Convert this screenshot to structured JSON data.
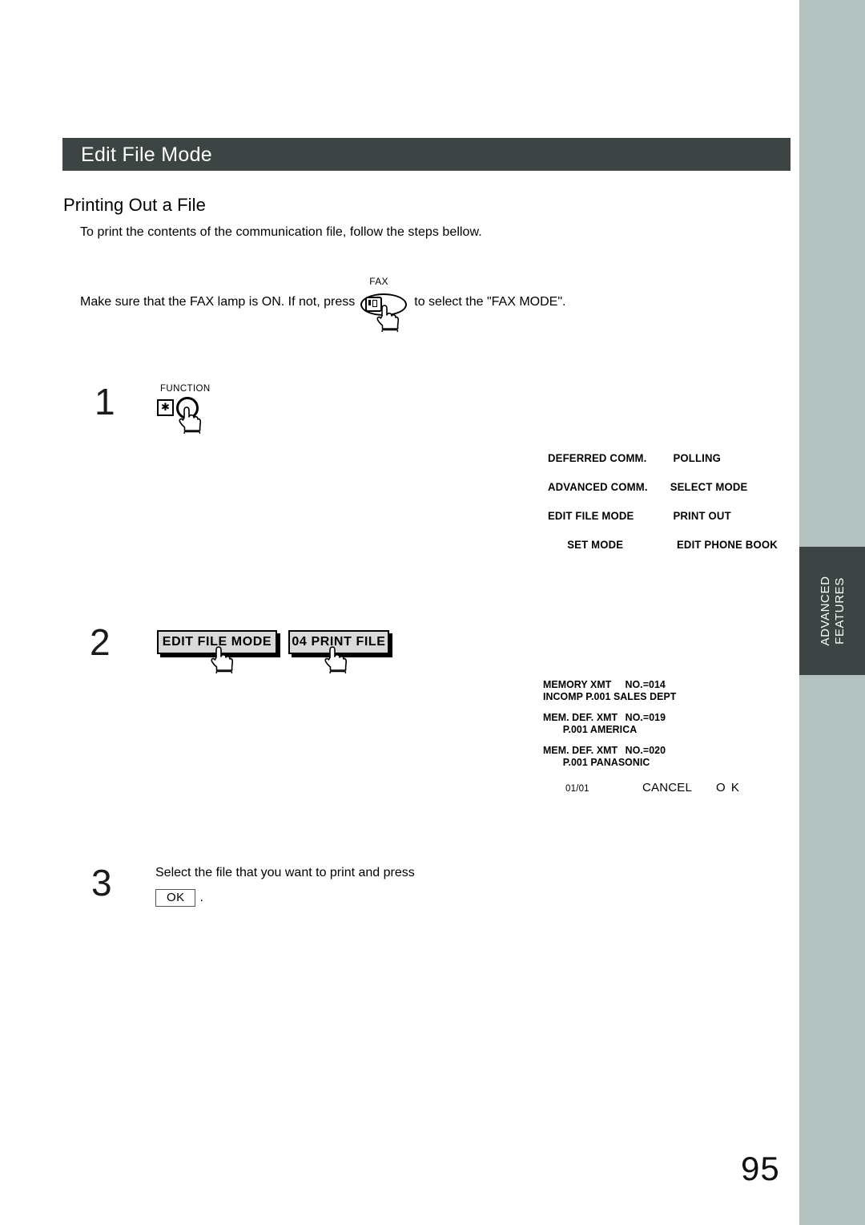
{
  "header": {
    "title": "Edit File Mode"
  },
  "section": {
    "heading": "Printing Out a File",
    "intro": "To print the contents of the communication file, follow the steps bellow."
  },
  "fax_instruction": {
    "before": "Make sure that the FAX lamp is ON.  If not, press",
    "key_label": "FAX",
    "key_icon": "fax-machine-icon",
    "after": "to select the \"FAX MODE\"."
  },
  "steps": [
    {
      "number": "1",
      "function_key_label": "FUNCTION",
      "star_key_label": "✱"
    },
    {
      "number": "2",
      "buttons": [
        {
          "label": "EDIT FILE MODE"
        },
        {
          "label": "04 PRINT FILE"
        }
      ]
    },
    {
      "number": "3",
      "text": "Select the file that you want to print and press",
      "ok_label": "OK",
      "period": "."
    }
  ],
  "menu_display": {
    "rows": [
      {
        "left": "DEFERRED COMM.",
        "right": "POLLING"
      },
      {
        "left": "ADVANCED COMM.",
        "right": "SELECT MODE"
      },
      {
        "left": "EDIT FILE MODE",
        "right": "PRINT OUT"
      },
      {
        "left": "SET MODE",
        "right": "EDIT PHONE BOOK"
      }
    ]
  },
  "file_display": {
    "entries": [
      {
        "line1_type": "MEMORY XMT",
        "line1_no": "NO.=014",
        "line2": "INCOMP P.001   SALES DEPT"
      },
      {
        "line1_type": "MEM. DEF. XMT",
        "line1_no": "NO.=019",
        "line2": "P.001   AMERICA"
      },
      {
        "line1_type": "MEM. DEF. XMT",
        "line1_no": "NO.=020",
        "line2": "P.001   PANASONIC"
      }
    ],
    "status": {
      "page_counter": "01/01",
      "cancel_label": "CANCEL",
      "ok_label": "O K"
    }
  },
  "side_tab": {
    "line1": "ADVANCED",
    "line2": "FEATURES"
  },
  "page_number": "95",
  "colors": {
    "header_bar": "#3c4444",
    "side_band": "#b4c2bf",
    "side_tab": "#3c4444",
    "button_face": "#d9d9d9"
  }
}
